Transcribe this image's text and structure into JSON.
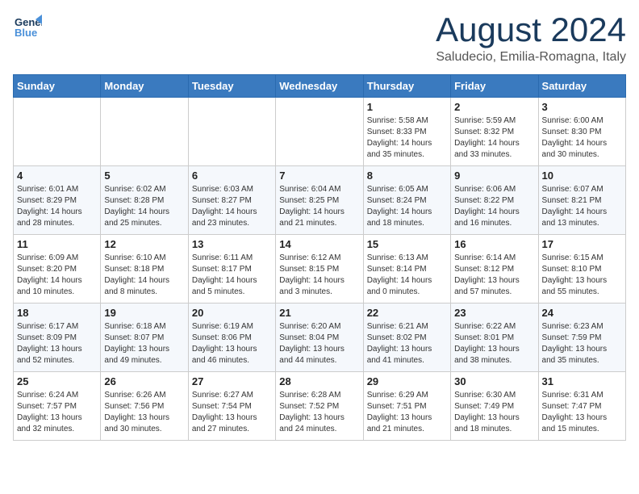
{
  "header": {
    "logo_line1": "General",
    "logo_line2": "Blue",
    "month_title": "August 2024",
    "location": "Saludecio, Emilia-Romagna, Italy"
  },
  "days_of_week": [
    "Sunday",
    "Monday",
    "Tuesday",
    "Wednesday",
    "Thursday",
    "Friday",
    "Saturday"
  ],
  "weeks": [
    [
      {
        "day": "",
        "info": ""
      },
      {
        "day": "",
        "info": ""
      },
      {
        "day": "",
        "info": ""
      },
      {
        "day": "",
        "info": ""
      },
      {
        "day": "1",
        "info": "Sunrise: 5:58 AM\nSunset: 8:33 PM\nDaylight: 14 hours\nand 35 minutes."
      },
      {
        "day": "2",
        "info": "Sunrise: 5:59 AM\nSunset: 8:32 PM\nDaylight: 14 hours\nand 33 minutes."
      },
      {
        "day": "3",
        "info": "Sunrise: 6:00 AM\nSunset: 8:30 PM\nDaylight: 14 hours\nand 30 minutes."
      }
    ],
    [
      {
        "day": "4",
        "info": "Sunrise: 6:01 AM\nSunset: 8:29 PM\nDaylight: 14 hours\nand 28 minutes."
      },
      {
        "day": "5",
        "info": "Sunrise: 6:02 AM\nSunset: 8:28 PM\nDaylight: 14 hours\nand 25 minutes."
      },
      {
        "day": "6",
        "info": "Sunrise: 6:03 AM\nSunset: 8:27 PM\nDaylight: 14 hours\nand 23 minutes."
      },
      {
        "day": "7",
        "info": "Sunrise: 6:04 AM\nSunset: 8:25 PM\nDaylight: 14 hours\nand 21 minutes."
      },
      {
        "day": "8",
        "info": "Sunrise: 6:05 AM\nSunset: 8:24 PM\nDaylight: 14 hours\nand 18 minutes."
      },
      {
        "day": "9",
        "info": "Sunrise: 6:06 AM\nSunset: 8:22 PM\nDaylight: 14 hours\nand 16 minutes."
      },
      {
        "day": "10",
        "info": "Sunrise: 6:07 AM\nSunset: 8:21 PM\nDaylight: 14 hours\nand 13 minutes."
      }
    ],
    [
      {
        "day": "11",
        "info": "Sunrise: 6:09 AM\nSunset: 8:20 PM\nDaylight: 14 hours\nand 10 minutes."
      },
      {
        "day": "12",
        "info": "Sunrise: 6:10 AM\nSunset: 8:18 PM\nDaylight: 14 hours\nand 8 minutes."
      },
      {
        "day": "13",
        "info": "Sunrise: 6:11 AM\nSunset: 8:17 PM\nDaylight: 14 hours\nand 5 minutes."
      },
      {
        "day": "14",
        "info": "Sunrise: 6:12 AM\nSunset: 8:15 PM\nDaylight: 14 hours\nand 3 minutes."
      },
      {
        "day": "15",
        "info": "Sunrise: 6:13 AM\nSunset: 8:14 PM\nDaylight: 14 hours\nand 0 minutes."
      },
      {
        "day": "16",
        "info": "Sunrise: 6:14 AM\nSunset: 8:12 PM\nDaylight: 13 hours\nand 57 minutes."
      },
      {
        "day": "17",
        "info": "Sunrise: 6:15 AM\nSunset: 8:10 PM\nDaylight: 13 hours\nand 55 minutes."
      }
    ],
    [
      {
        "day": "18",
        "info": "Sunrise: 6:17 AM\nSunset: 8:09 PM\nDaylight: 13 hours\nand 52 minutes."
      },
      {
        "day": "19",
        "info": "Sunrise: 6:18 AM\nSunset: 8:07 PM\nDaylight: 13 hours\nand 49 minutes."
      },
      {
        "day": "20",
        "info": "Sunrise: 6:19 AM\nSunset: 8:06 PM\nDaylight: 13 hours\nand 46 minutes."
      },
      {
        "day": "21",
        "info": "Sunrise: 6:20 AM\nSunset: 8:04 PM\nDaylight: 13 hours\nand 44 minutes."
      },
      {
        "day": "22",
        "info": "Sunrise: 6:21 AM\nSunset: 8:02 PM\nDaylight: 13 hours\nand 41 minutes."
      },
      {
        "day": "23",
        "info": "Sunrise: 6:22 AM\nSunset: 8:01 PM\nDaylight: 13 hours\nand 38 minutes."
      },
      {
        "day": "24",
        "info": "Sunrise: 6:23 AM\nSunset: 7:59 PM\nDaylight: 13 hours\nand 35 minutes."
      }
    ],
    [
      {
        "day": "25",
        "info": "Sunrise: 6:24 AM\nSunset: 7:57 PM\nDaylight: 13 hours\nand 32 minutes."
      },
      {
        "day": "26",
        "info": "Sunrise: 6:26 AM\nSunset: 7:56 PM\nDaylight: 13 hours\nand 30 minutes."
      },
      {
        "day": "27",
        "info": "Sunrise: 6:27 AM\nSunset: 7:54 PM\nDaylight: 13 hours\nand 27 minutes."
      },
      {
        "day": "28",
        "info": "Sunrise: 6:28 AM\nSunset: 7:52 PM\nDaylight: 13 hours\nand 24 minutes."
      },
      {
        "day": "29",
        "info": "Sunrise: 6:29 AM\nSunset: 7:51 PM\nDaylight: 13 hours\nand 21 minutes."
      },
      {
        "day": "30",
        "info": "Sunrise: 6:30 AM\nSunset: 7:49 PM\nDaylight: 13 hours\nand 18 minutes."
      },
      {
        "day": "31",
        "info": "Sunrise: 6:31 AM\nSunset: 7:47 PM\nDaylight: 13 hours\nand 15 minutes."
      }
    ]
  ]
}
